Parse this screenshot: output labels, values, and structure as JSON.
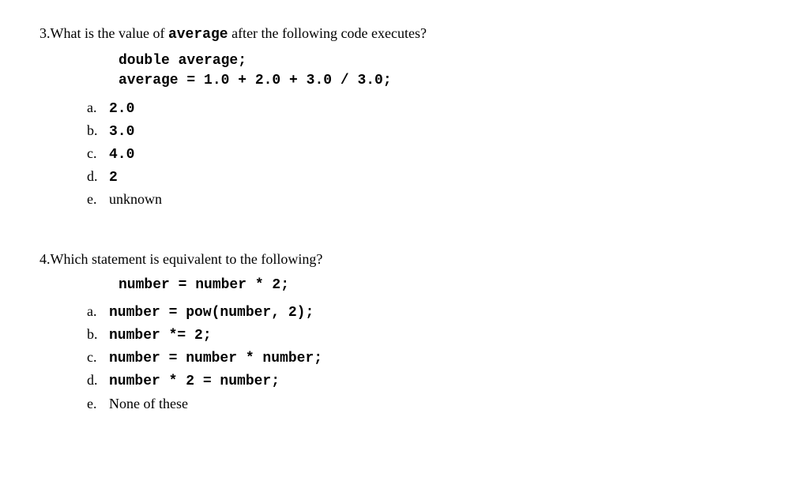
{
  "q3": {
    "number": "3.",
    "prompt_pre": "What is the value of ",
    "prompt_code": "average",
    "prompt_post": " after the following code executes?",
    "code": "double average;\naverage = 1.0 + 2.0 + 3.0 / 3.0;",
    "choices": [
      {
        "letter": "a.",
        "text": "2.0",
        "mono": true
      },
      {
        "letter": "b.",
        "text": "3.0",
        "mono": true
      },
      {
        "letter": "c.",
        "text": "4.0",
        "mono": true
      },
      {
        "letter": "d.",
        "text": "2",
        "mono": true
      },
      {
        "letter": "e.",
        "text": "unknown",
        "mono": false
      }
    ]
  },
  "q4": {
    "number": "4.",
    "prompt": "Which statement is equivalent to the following?",
    "code": "number = number * 2;",
    "choices": [
      {
        "letter": "a.",
        "text": "number = pow(number, 2);",
        "mono": true
      },
      {
        "letter": "b.",
        "text": "number *= 2;",
        "mono": true
      },
      {
        "letter": "c.",
        "text": "number = number * number;",
        "mono": true
      },
      {
        "letter": "d.",
        "text": "number * 2 = number;",
        "mono": true
      },
      {
        "letter": "e.",
        "text": "None of these",
        "mono": false
      }
    ]
  }
}
